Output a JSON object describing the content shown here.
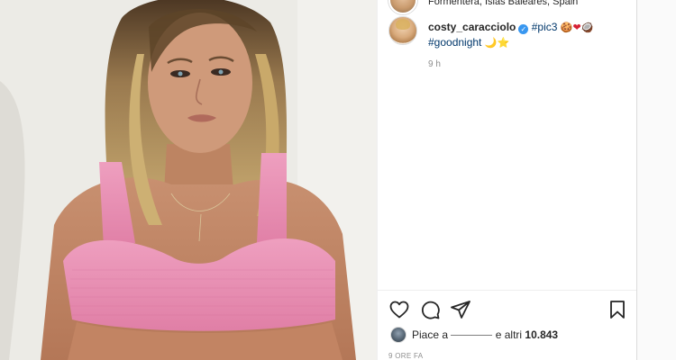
{
  "post": {
    "location": "Formentera, Islas Baleares, Spain",
    "caption": {
      "username": "costy_caracciolo",
      "verified_badge": "✓",
      "hashtag_1": "#pic3",
      "hashtag_2": "#goodnight",
      "emojis_line1": [
        "🍪",
        "❤",
        "🥥"
      ],
      "emojis_line2": [
        "🌙",
        "⭐"
      ]
    },
    "time_ago": "9 h",
    "likes": {
      "prefix": "Piace a",
      "suffix": "e altri",
      "count": "10.843"
    },
    "posted_ago": "9 ORE FA"
  },
  "icons": {
    "like": "heart-icon",
    "comment": "comment-icon",
    "share": "paper-plane-icon",
    "save": "bookmark-icon"
  },
  "colors": {
    "hashtag": "#00376b",
    "verified": "#3897f0",
    "muted": "#8e8e8e",
    "text": "#262626",
    "top_pink": "#e88fb0"
  }
}
